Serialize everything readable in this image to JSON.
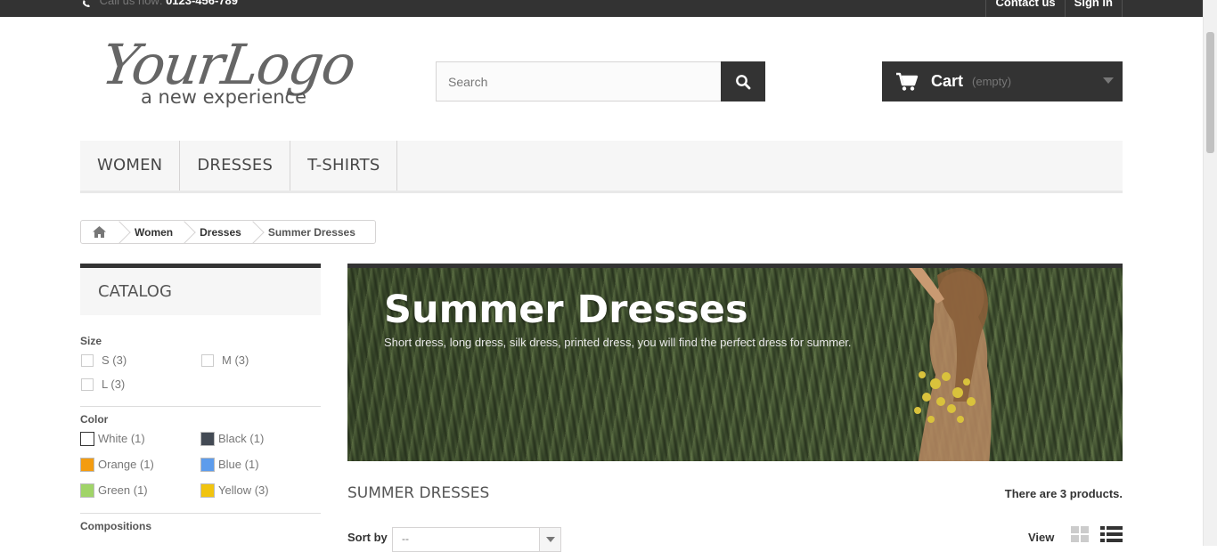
{
  "topbar": {
    "phone_prefix": "Call us now:",
    "phone_number": "0123-456-789",
    "links": [
      "Contact us",
      "Sign in"
    ]
  },
  "logo": {
    "brand": "YourLogo",
    "tagline": "a new experience"
  },
  "search": {
    "placeholder": "Search"
  },
  "cart": {
    "label": "Cart",
    "status": "(empty)"
  },
  "menu": {
    "items": [
      "WOMEN",
      "DRESSES",
      "T-SHIRTS"
    ]
  },
  "breadcrumb": {
    "items": [
      "Women",
      "Dresses",
      "Summer Dresses"
    ]
  },
  "sidebar": {
    "title": "CATALOG",
    "size": {
      "title": "Size",
      "options": [
        "S (3)",
        "M (3)",
        "L (3)"
      ]
    },
    "color": {
      "title": "Color",
      "options": [
        {
          "label": "White (1)",
          "swatch": "#ffffff"
        },
        {
          "label": "Black (1)",
          "swatch": "#434A54"
        },
        {
          "label": "Orange (1)",
          "swatch": "#F39C11"
        },
        {
          "label": "Blue (1)",
          "swatch": "#5D9CEC"
        },
        {
          "label": "Green (1)",
          "swatch": "#A0D468"
        },
        {
          "label": "Yellow (3)",
          "swatch": "#F1C40F"
        }
      ]
    },
    "compositions_title": "Compositions"
  },
  "banner": {
    "title": "Summer Dresses",
    "description": "Short dress, long dress, silk dress, printed dress, you will find the perfect dress for summer."
  },
  "products": {
    "heading": "SUMMER DRESSES",
    "count_text": "There are 3 products."
  },
  "sorting": {
    "label": "Sort by",
    "selected": "--",
    "view_label": "View"
  }
}
